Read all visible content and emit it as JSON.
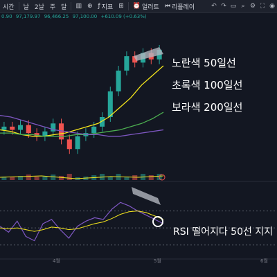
{
  "toolbar": {
    "interval_label": "시간",
    "day_label": "날",
    "week_label": "2날",
    "calendar_label": "주",
    "period_label": "달",
    "indicators_label": "지표",
    "alert_label": "얼러트",
    "replay_label": "리플레이"
  },
  "ohlc": {
    "open": "0.90",
    "high": "97,179.97",
    "low": "96,466.25",
    "close": "97,100.00",
    "change": "+610.09 (+0.63%)"
  },
  "annotations": {
    "ma50": "노란색 50일선",
    "ma100": "초록색 100일선",
    "ma200": "보라색 200일선",
    "rsi_note": "RSI 떨어지다 50선 지지"
  },
  "x_axis": {
    "ticks": [
      "4월",
      "5월",
      "6월"
    ]
  },
  "colors": {
    "background": "#131722",
    "up": "#26a69a",
    "down": "#ef5350",
    "ma50": "#f5e61c",
    "ma100": "#4caf50",
    "ma200": "#7e57c2",
    "rsi": "#7e57c2",
    "rsi_ma": "#f5e61c",
    "annotation_arrow": "#b2b5be",
    "volume_ma": "#f5e61c"
  },
  "chart_data": [
    {
      "type": "line",
      "name": "price-pane",
      "description_series": "candles with moving averages",
      "series": [
        {
          "name": "노란색 50일선",
          "values": [
            64,
            63,
            61,
            60,
            60,
            61,
            62,
            64,
            66,
            68,
            72,
            78,
            84,
            92,
            98,
            104
          ]
        },
        {
          "name": "초록색 100일선",
          "values": [
            62,
            62,
            61,
            61,
            60,
            60,
            60,
            61,
            61,
            62,
            63,
            64,
            66,
            68,
            71,
            75
          ]
        },
        {
          "name": "보라색 200일선",
          "values": [
            73,
            72,
            70,
            68,
            66,
            64,
            63,
            62,
            61,
            61,
            60,
            60,
            61,
            62,
            63,
            64
          ]
        }
      ],
      "candle_close": [
        66,
        64,
        67,
        62,
        60,
        63,
        68,
        58,
        52,
        60,
        62,
        66,
        72,
        88,
        101,
        110,
        106,
        112,
        108,
        114
      ]
    },
    {
      "type": "line",
      "name": "rsi-pane",
      "series": [
        {
          "name": "RSI",
          "values": [
            52,
            45,
            58,
            40,
            35,
            55,
            60,
            48,
            38,
            52,
            58,
            62,
            60,
            72,
            80,
            76,
            70,
            65,
            60,
            55
          ]
        },
        {
          "name": "RSI MA",
          "values": [
            50,
            49,
            50,
            48,
            46,
            48,
            51,
            50,
            48,
            49,
            52,
            55,
            57,
            61,
            66,
            69,
            70,
            68,
            64,
            60
          ]
        }
      ],
      "levels": [
        70,
        50,
        30
      ]
    }
  ]
}
